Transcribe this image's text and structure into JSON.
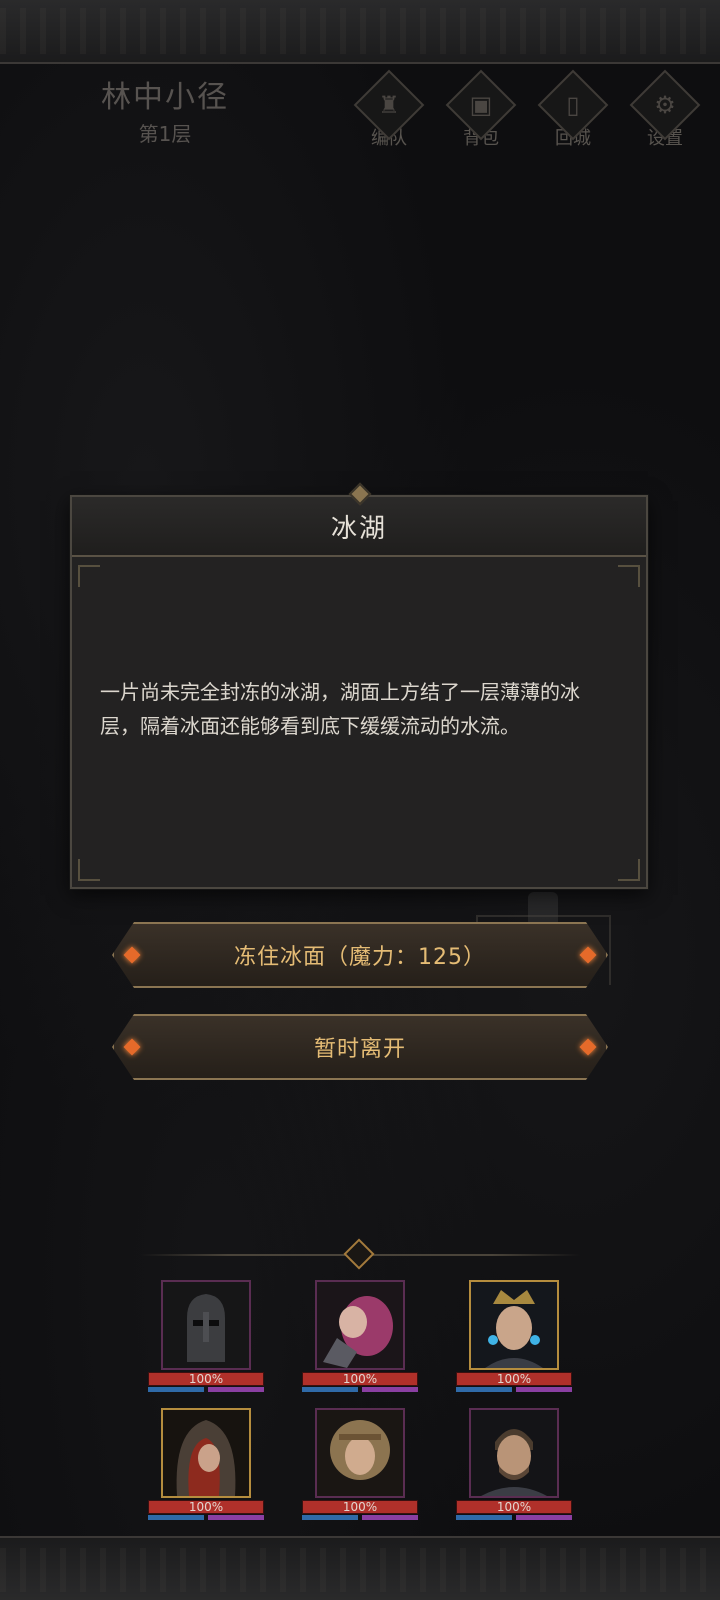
{
  "header": {
    "location_name": "林中小径",
    "floor_label": "第1层"
  },
  "menu": [
    {
      "label": "编队",
      "icon": "horned-helmet-icon",
      "glyph": "♜"
    },
    {
      "label": "背包",
      "icon": "backpack-icon",
      "glyph": "▣"
    },
    {
      "label": "回城",
      "icon": "door-icon",
      "glyph": "▯"
    },
    {
      "label": "设置",
      "icon": "gear-icon",
      "glyph": "⚙"
    }
  ],
  "event": {
    "title": "冰湖",
    "description": "一片尚未完全封冻的冰湖，湖面上方结了一层薄薄的冰层，隔着冰面还能够看到底下缓缓流动的水流。"
  },
  "actions": {
    "freeze_label": "冻住冰面（魔力：125）",
    "leave_label": "暂时离开"
  },
  "party": [
    {
      "name_icon": "knight-portrait",
      "hp_percent": 100,
      "hp_label": "100%"
    },
    {
      "name_icon": "pink-hair-warrior-portrait",
      "hp_percent": 100,
      "hp_label": "100%"
    },
    {
      "name_icon": "crowned-mage-portrait",
      "hp_percent": 100,
      "hp_label": "100%"
    },
    {
      "name_icon": "red-hooded-woman-portrait",
      "hp_percent": 100,
      "hp_label": "100%"
    },
    {
      "name_icon": "blonde-woman-portrait",
      "hp_percent": 100,
      "hp_label": "100%"
    },
    {
      "name_icon": "bearded-man-portrait",
      "hp_percent": 100,
      "hp_label": "100%"
    }
  ],
  "colors": {
    "accent_gold": "#e5bc75",
    "hp_red": "#b0302a",
    "mp_blue": "#2f6aa8",
    "mp_purple": "#8a3fa2",
    "gem_orange": "#e56a2a"
  }
}
